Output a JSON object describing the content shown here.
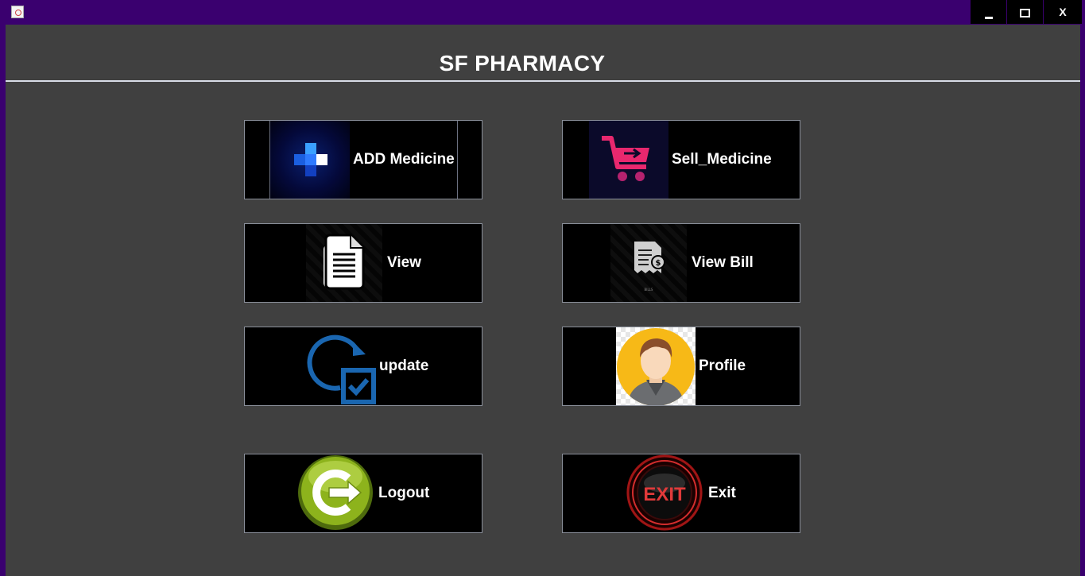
{
  "window": {
    "controls": {
      "minimize": "minimize",
      "maximize": "maximize",
      "close": "X"
    }
  },
  "header": {
    "title": "SF PHARMACY"
  },
  "tiles": {
    "add_medicine": {
      "label": "ADD Medicine",
      "icon": "medical-cross-icon"
    },
    "sell_medicine": {
      "label": "Sell_Medicine",
      "icon": "shopping-cart-icon"
    },
    "view": {
      "label": "View",
      "icon": "document-icon"
    },
    "view_bill": {
      "label": "View Bill",
      "icon": "bill-receipt-icon",
      "art_caption": "BILLS"
    },
    "update": {
      "label": "update",
      "icon": "refresh-check-icon"
    },
    "profile": {
      "label": "Profile",
      "icon": "user-avatar-icon"
    },
    "logout": {
      "label": "Logout",
      "icon": "logout-power-icon"
    },
    "exit": {
      "label": "Exit",
      "icon": "exit-button-icon",
      "art_text": "EXIT"
    }
  },
  "colors": {
    "titlebar": "#3a006f",
    "background": "#404040",
    "tile": "#000000",
    "accent_blue": "#1a66b0",
    "cart_pink": "#e8286e",
    "logout_green": "#8db31c",
    "exit_red": "#d42d2d"
  }
}
